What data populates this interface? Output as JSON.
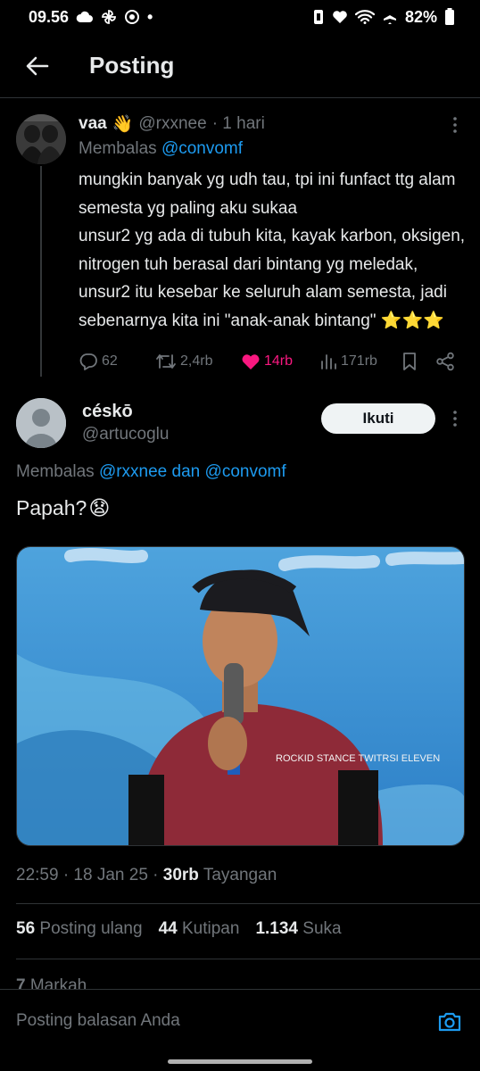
{
  "status_bar": {
    "time": "09.56",
    "battery": "82%",
    "dot": "•"
  },
  "header": {
    "title": "Posting"
  },
  "parent_tweet": {
    "name": "vaa",
    "emoji": "👋",
    "handle": "@rxxnee",
    "time": "· 1 hari",
    "replying_prefix": "Membalas",
    "replying_to": "@convomf",
    "text": "mungkin banyak yg udh tau, tpi ini funfact ttg alam semesta yg paling aku sukaa\nunsur2 yg ada di tubuh kita, kayak karbon, oksigen, nitrogen tuh berasal dari bintang yg meledak, unsur2 itu kesebar ke seluruh alam semesta, jadi sebenarnya kita ini \"anak-anak bintang\" ⭐⭐⭐",
    "replies": "62",
    "reposts": "2,4rb",
    "likes": "14rb",
    "views": "171rb"
  },
  "main_tweet": {
    "name": "céskō",
    "handle": "@artucoglu",
    "follow_label": "Ikuti",
    "replying_prefix": "Membalas",
    "replying_to_1": "@rxxnee",
    "replying_and": "dan",
    "replying_to_2": "@convomf",
    "text": "Papah?",
    "emoji": "😧",
    "photo_shirt_text": "ROCKID STANCE TWITRSI ELEVEN"
  },
  "meta": {
    "time": "22:59",
    "date": "· 18 Jan 25 ·",
    "views_count": "30rb",
    "views_label": "Tayangan"
  },
  "stats": {
    "reposts_count": "56",
    "reposts_label": "Posting ulang",
    "quotes_count": "44",
    "quotes_label": "Kutipan",
    "likes_count": "1.134",
    "likes_label": "Suka",
    "bookmarks_count": "7",
    "bookmarks_label": "Markah"
  },
  "reply_bar": {
    "placeholder": "Posting balasan Anda"
  },
  "colors": {
    "accent": "#1d9bf0",
    "like": "#f91880",
    "muted": "#71767b",
    "border": "#2f3336"
  }
}
